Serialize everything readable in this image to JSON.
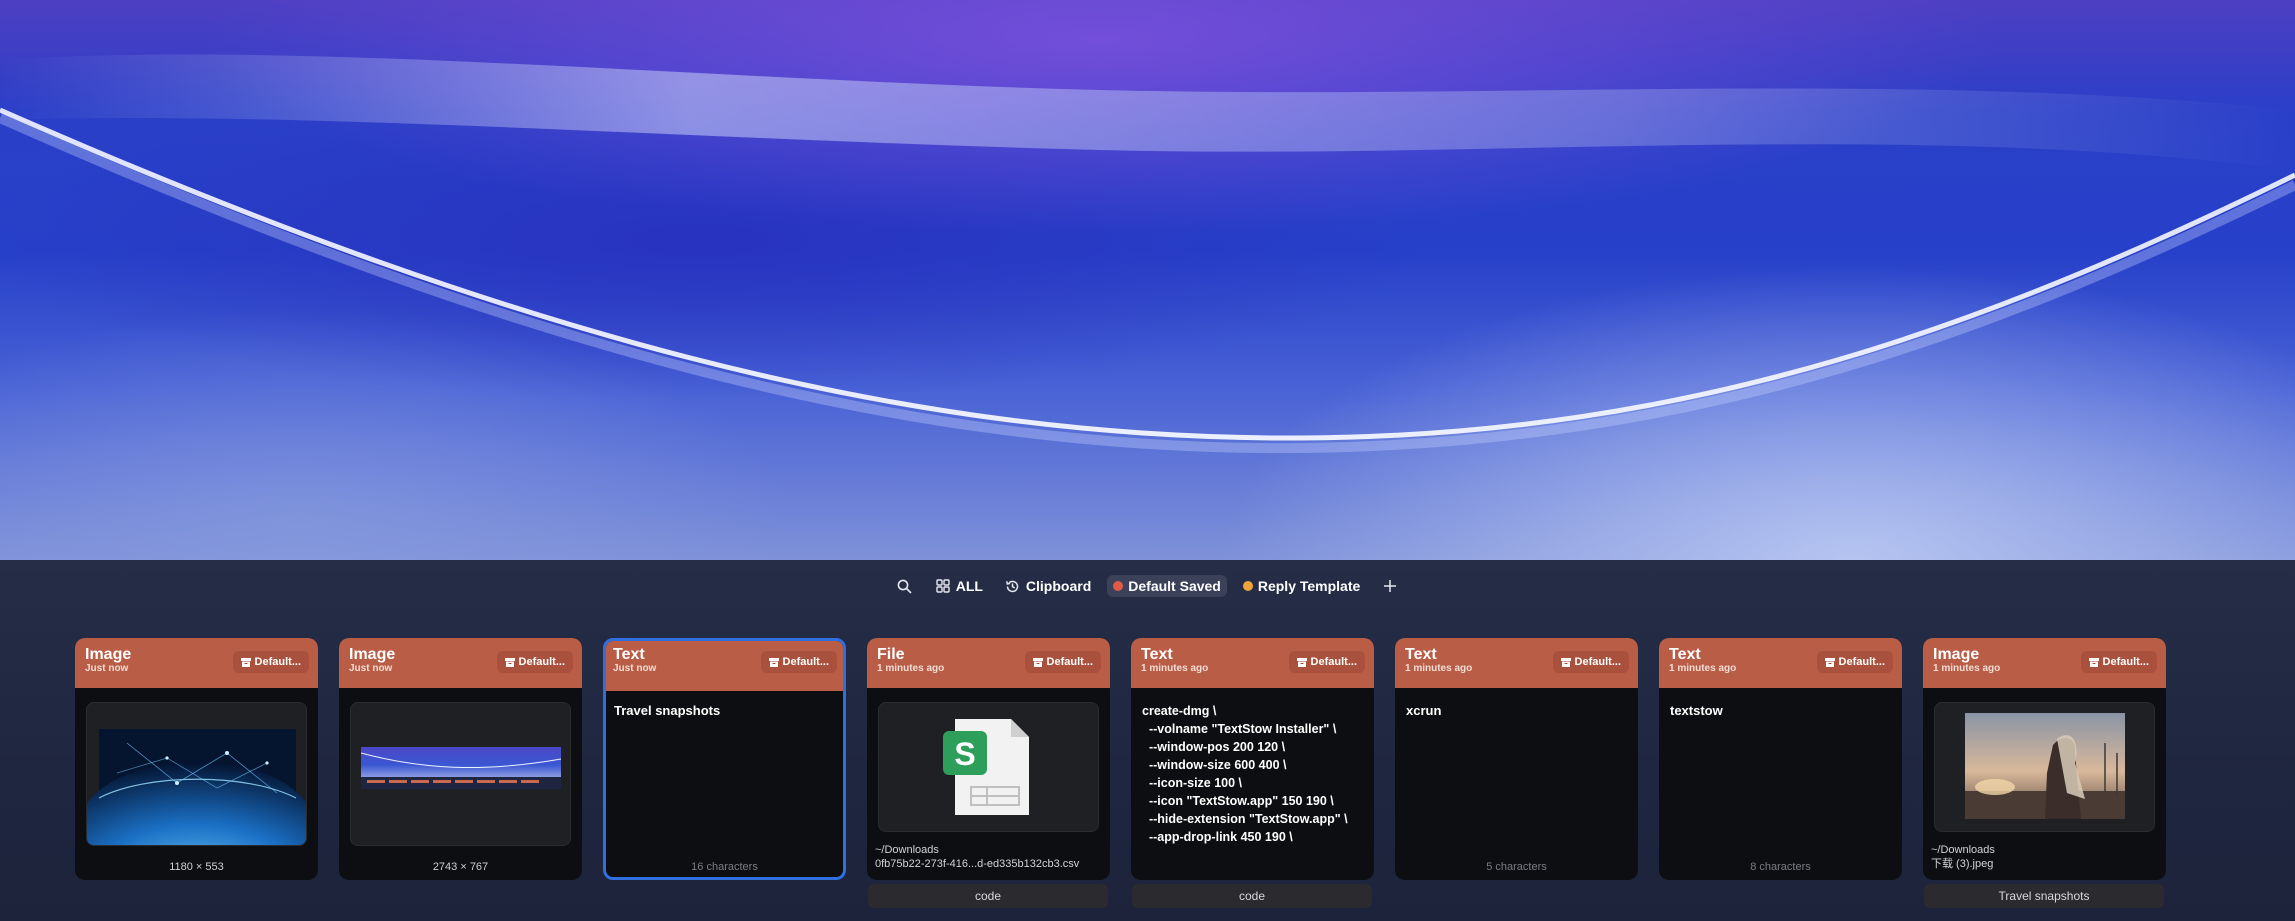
{
  "toolbar": {
    "search_icon": "search-icon",
    "all_label": "ALL",
    "clipboard_label": "Clipboard",
    "default_saved_label": "Default Saved",
    "default_saved_color": "#e05a47",
    "reply_template_label": "Reply Template",
    "reply_template_color": "#f0a43a",
    "add_icon": "plus-icon"
  },
  "colors": {
    "card_header": "#b95d46",
    "selection": "#2f6fe0"
  },
  "cards": [
    {
      "type": "Image",
      "time": "Just now",
      "tag": "Default...",
      "footer": "1180 × 553"
    },
    {
      "type": "Image",
      "time": "Just now",
      "tag": "Default...",
      "footer": "2743 × 767"
    },
    {
      "type": "Text",
      "time": "Just now",
      "tag": "Default...",
      "content": "Travel snapshots",
      "footer": "16 characters"
    },
    {
      "type": "File",
      "time": "1 minutes ago",
      "tag": "Default...",
      "path_line1": "~/Downloads",
      "path_line2": "0fb75b22-273f-416...d-ed335b132cb3.csv",
      "below": "code"
    },
    {
      "type": "Text",
      "time": "1 minutes ago",
      "tag": "Default...",
      "content": "create-dmg \\\n  --volname \"TextStow Installer\" \\\n  --window-pos 200 120 \\\n  --window-size 600 400 \\\n  --icon-size 100 \\\n  --icon \"TextStow.app\" 150 190 \\\n  --hide-extension \"TextStow.app\" \\\n  --app-drop-link 450 190 \\",
      "below": "code"
    },
    {
      "type": "Text",
      "time": "1 minutes ago",
      "tag": "Default...",
      "content": "xcrun",
      "footer": "5 characters"
    },
    {
      "type": "Text",
      "time": "1 minutes ago",
      "tag": "Default...",
      "content": "textstow",
      "footer": "8 characters"
    },
    {
      "type": "Image",
      "time": "1 minutes ago",
      "tag": "Default...",
      "path_line1": "~/Downloads",
      "path_line2": "下载 (3).jpeg",
      "below": "Travel snapshots"
    }
  ]
}
